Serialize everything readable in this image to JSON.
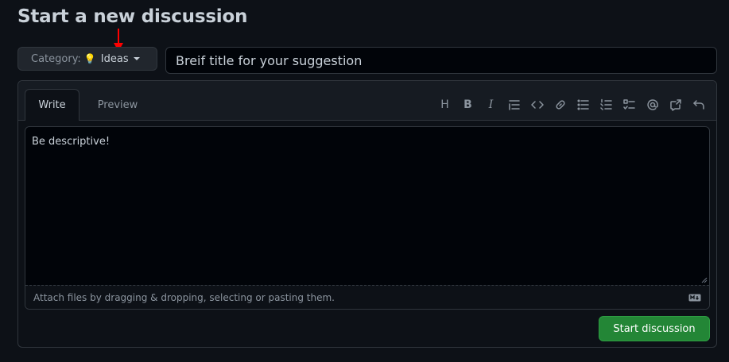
{
  "page": {
    "title": "Start a new discussion"
  },
  "category": {
    "label": "Category:",
    "icon": "lightbulb-icon",
    "icon_glyph": "💡",
    "value": "Ideas"
  },
  "title_input": {
    "value": "Breif title for your suggestion"
  },
  "editor": {
    "tabs": [
      {
        "label": "Write",
        "active": true
      },
      {
        "label": "Preview",
        "active": false
      }
    ],
    "toolbar": [
      "heading-icon",
      "bold-icon",
      "italic-icon",
      "quote-icon",
      "code-icon",
      "link-icon",
      "bullet-list-icon",
      "numbered-list-icon",
      "task-list-icon",
      "mention-icon",
      "reference-icon",
      "undo-icon"
    ],
    "toolbar_heading_glyph": "H",
    "toolbar_bold_glyph": "B",
    "toolbar_italic_glyph": "I",
    "body_value": "Be descriptive!",
    "attach_hint": "Attach files by dragging & dropping, selecting or pasting them.",
    "markdown_badge": "M↓"
  },
  "actions": {
    "submit_label": "Start discussion"
  },
  "colors": {
    "background": "#0d1117",
    "accent_green": "#238636",
    "annotation_arrow": "#ff0000"
  }
}
